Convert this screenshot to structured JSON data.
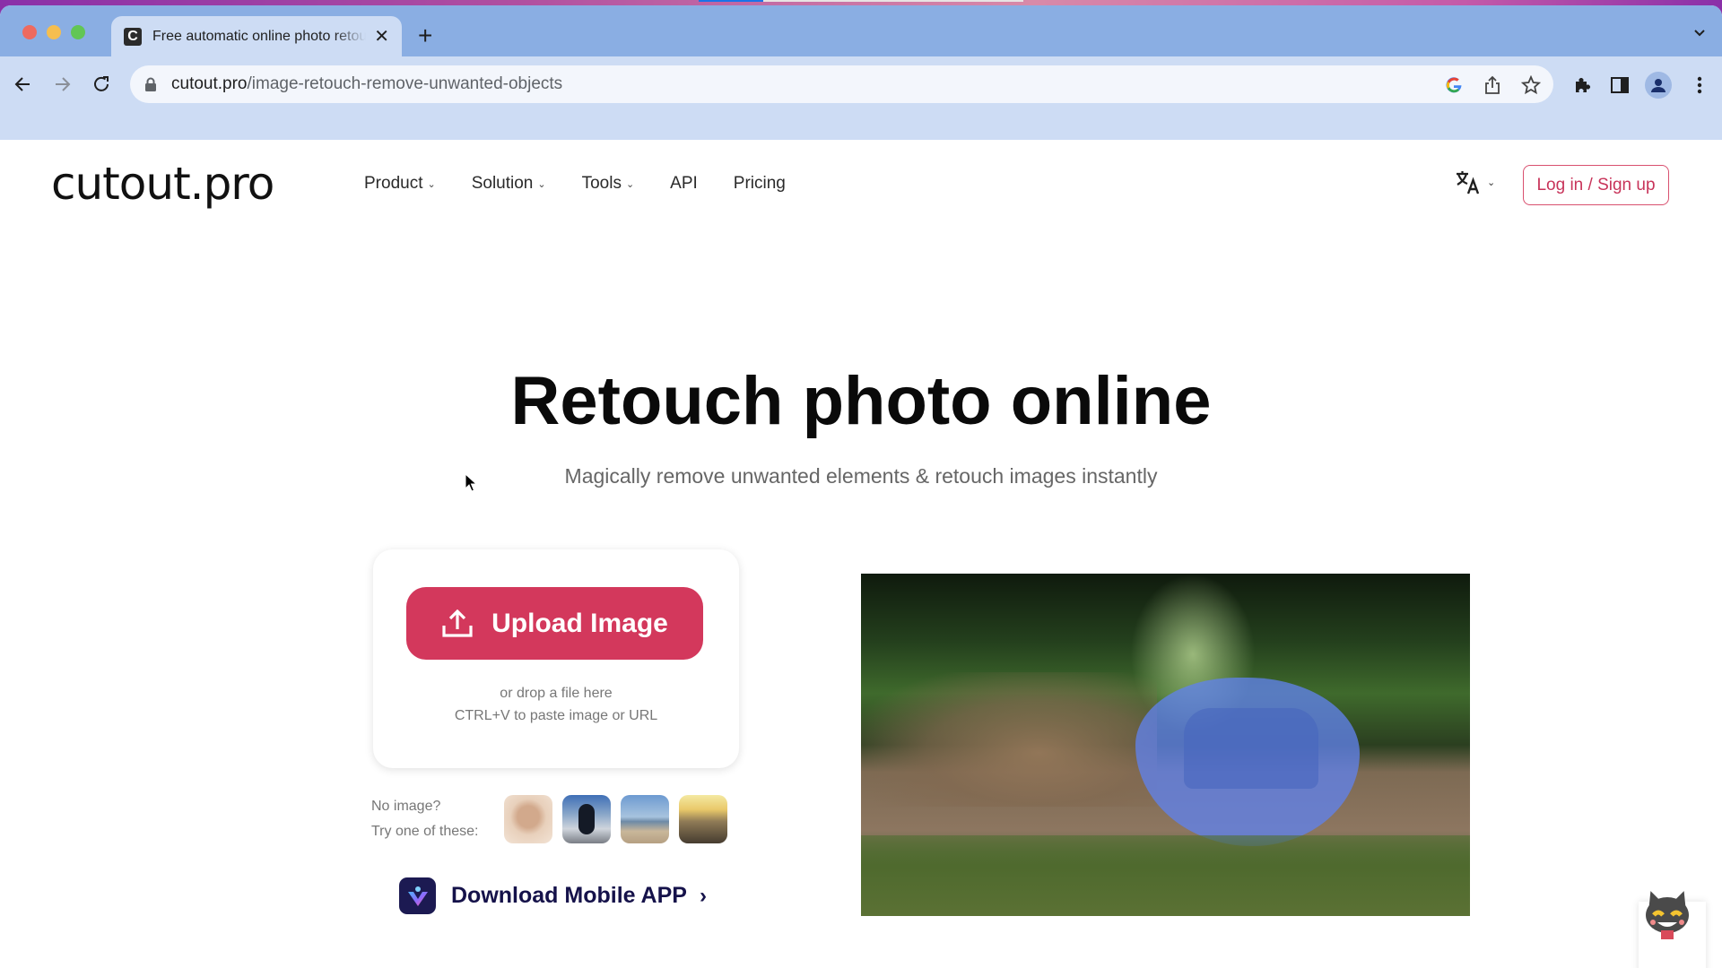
{
  "browser": {
    "tab": {
      "title": "Free automatic online photo retouch",
      "favicon_letter": "C",
      "close_icon": "close-icon"
    },
    "new_tab_label": "+",
    "url": {
      "host": "cutout.pro",
      "path": "/image-retouch-remove-unwanted-objects"
    },
    "icons": [
      "back-icon",
      "forward-icon",
      "reload-icon",
      "lock-icon",
      "google-icon",
      "share-icon",
      "star-icon",
      "extensions-icon",
      "side-panel-icon",
      "profile-icon",
      "more-icon",
      "tab-search-icon"
    ]
  },
  "site": {
    "logo": "cutout.pro",
    "nav": [
      {
        "label": "Product",
        "has_dropdown": true
      },
      {
        "label": "Solution",
        "has_dropdown": true
      },
      {
        "label": "Tools",
        "has_dropdown": true
      },
      {
        "label": "API",
        "has_dropdown": false
      },
      {
        "label": "Pricing",
        "has_dropdown": false
      }
    ],
    "language_icon": "translate-icon",
    "login_label": "Log in / Sign up",
    "accent_color": "#d3385c"
  },
  "hero": {
    "title": "Retouch photo online",
    "subtitle": "Magically remove unwanted elements & retouch images instantly"
  },
  "upload": {
    "button_label": "Upload Image",
    "drop_hint": "or drop a file here",
    "paste_hint": "CTRL+V to paste image or URL"
  },
  "samples": {
    "line1": "No image?",
    "line2": "Try one of these:",
    "thumbs": [
      "portrait-woman",
      "person-street",
      "beach",
      "sunset-pier"
    ]
  },
  "download_app": {
    "label": "Download Mobile APP",
    "chevron": "›"
  },
  "demo": {
    "description": "rally car on dirt road with blue selection mask"
  }
}
